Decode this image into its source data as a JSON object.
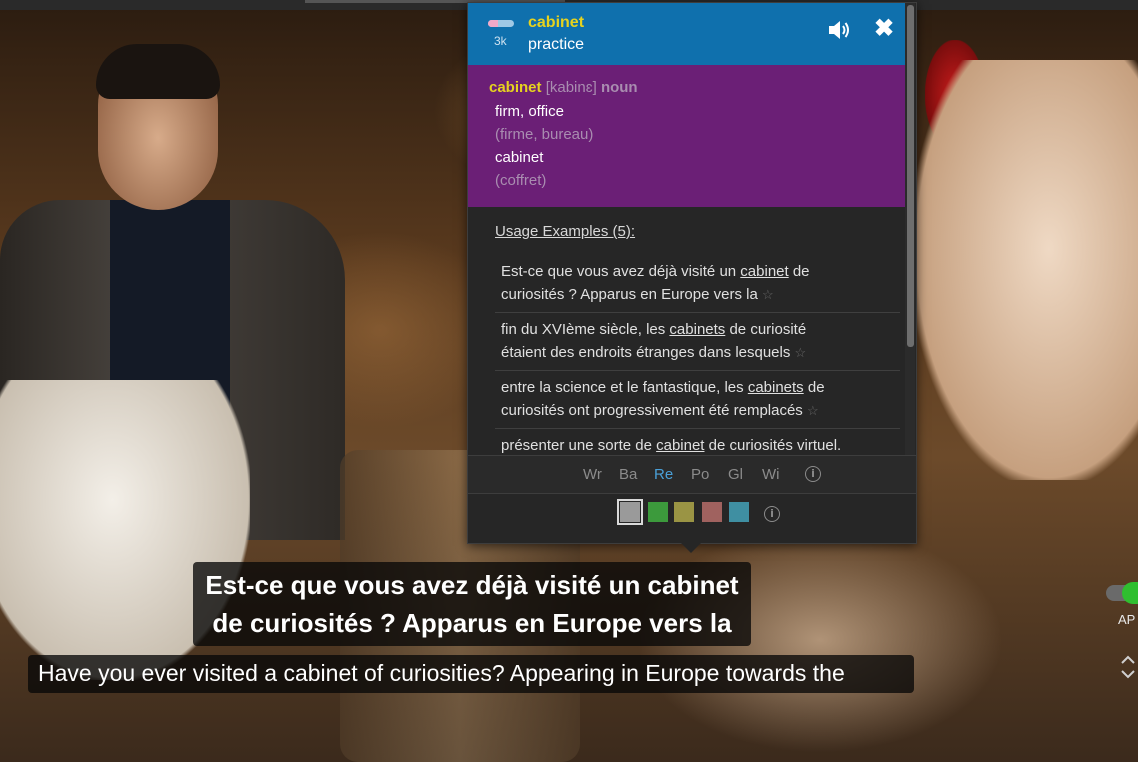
{
  "header": {
    "word": "cabinet",
    "action": "practice",
    "frequency_count": "3k",
    "frequency_level": 0.4
  },
  "definition": {
    "word": "cabinet",
    "pronunciation": "[kabinɛ]",
    "part_of_speech": "noun",
    "senses": [
      {
        "translation": "firm, office",
        "gloss": "(firme, bureau)"
      },
      {
        "translation": "cabinet",
        "gloss": "(coffret)"
      }
    ]
  },
  "usage": {
    "title": "Usage Examples (5):",
    "examples": [
      {
        "line1_pre": "Est-ce que vous avez déjà visité un ",
        "line1_hl": "cabinet",
        "line1_post": " de",
        "line2": "curiosités ? Apparus en Europe vers la"
      },
      {
        "line1_pre": "fin du XVIème siècle, les ",
        "line1_hl": "cabinets",
        "line1_post": " de curiosité",
        "line2": "étaient des endroits étranges dans lesquels"
      },
      {
        "line1_pre": "entre la science et le fantastique, les ",
        "line1_hl": "cabinets",
        "line1_post": " de",
        "line2": "curiosités ont progressivement été remplacés"
      },
      {
        "line1_pre": "présenter une sorte de ",
        "line1_hl": "cabinet",
        "line1_post": " de curiosités virtuel.",
        "line2": ""
      }
    ],
    "star_glyph": "☆"
  },
  "sources": {
    "items": [
      "Wr",
      "Ba",
      "Re",
      "Po",
      "Gl",
      "Wi"
    ],
    "active": "Re",
    "info_glyph": "i"
  },
  "highlight_colors": [
    "#9a9a9a",
    "#3c9a3c",
    "#9a9444",
    "#a0625f",
    "#3f8fa2"
  ],
  "subtitles": {
    "french_line1": "Est-ce que vous avez déjà visité un cabinet",
    "french_line2": "de curiosités ? Apparus en Europe vers la",
    "english": "Have you ever visited a cabinet of curiosities? Appearing in Europe towards the"
  },
  "player_controls": {
    "autopause_label": "AP"
  },
  "icons": {
    "speaker": "speaker-icon",
    "close": "close-icon",
    "close_glyph": "✖"
  }
}
